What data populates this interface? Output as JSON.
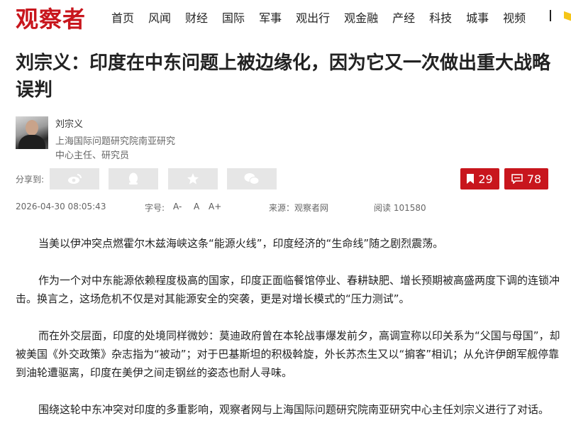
{
  "brand": {
    "logo_text": "观察者",
    "accent": "#c8161d"
  },
  "nav": {
    "items": [
      {
        "label": "首页"
      },
      {
        "label": "风闻"
      },
      {
        "label": "财经"
      },
      {
        "label": "国际"
      },
      {
        "label": "军事"
      },
      {
        "label": "观出行"
      },
      {
        "label": "观金融"
      },
      {
        "label": "产经"
      },
      {
        "label": "科技"
      },
      {
        "label": "城事"
      },
      {
        "label": "视频"
      }
    ]
  },
  "article": {
    "title": "刘宗义：印度在中东问题上被边缘化，因为它又一次做出重大战略误判",
    "author": {
      "name": "刘宗义",
      "bio": "上海国际问题研究院南亚研究中心主任、研究员"
    },
    "share": {
      "label": "分享到:",
      "icons": [
        "weibo-icon",
        "qq-icon",
        "qzone-star-icon",
        "wechat-icon"
      ]
    },
    "bookmark_count": "29",
    "comment_count": "78",
    "meta": {
      "datetime": "2026-04-30 08:05:43",
      "font_label": "字号:",
      "font_small": "A-",
      "font_mid": "A",
      "font_large": "A+",
      "source": "来源：观察者网",
      "reads": "阅读 101580"
    },
    "paragraphs": [
      "当美以伊冲突点燃霍尔木兹海峡这条“能源火线”，印度经济的“生命线”随之剧烈震荡。",
      "作为一个对中东能源依赖程度极高的国家，印度正面临餐馆停业、春耕缺肥、增长预期被高盛两度下调的连锁冲击。换言之，这场危机不仅是对其能源安全的突袭，更是对增长模式的“压力测试”。",
      "而在外交层面，印度的处境同样微妙：莫迪政府曾在本轮战事爆发前夕，高调宣称以印关系为“父国与母国”，却被美国《外交政策》杂志指为“被动”；对于巴基斯坦的积极斡旋，外长苏杰生又以“掮客”相讥；从允许伊朗军舰停靠到油轮遭驱离，印度在美伊之间走钢丝的姿态也耐人寻味。",
      "围绕这轮中东冲突对印度的多重影响，观察者网与上海国际问题研究院南亚研究中心主任刘宗义进行了对话。"
    ]
  }
}
